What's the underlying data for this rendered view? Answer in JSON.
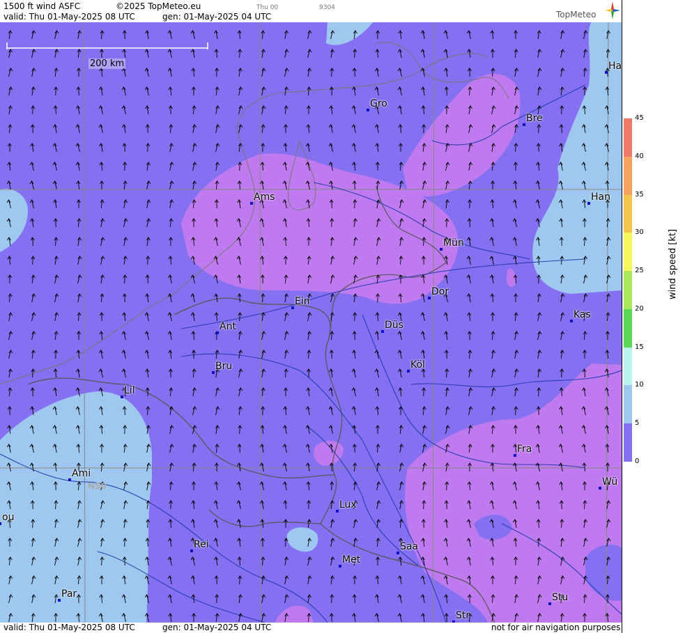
{
  "header": {
    "product": "1500 ft wind ASFC",
    "copyright": "©2025 TopMeteo.eu",
    "run": "Thu 00",
    "code": "9304",
    "valid": "valid:  Thu  01-May-2025  08 UTC",
    "gen": "gen: 01-May-2025 04 UTC",
    "logo": "TopMeteo"
  },
  "footer": {
    "valid": "valid:  Thu  01-May-2025  08 UTC",
    "gen": "gen: 01-May-2025 04 UTC",
    "disclaimer": "not for air navigation purposes"
  },
  "map": {
    "scale_label": "200 km",
    "latitude_label": "N50",
    "cities": [
      {
        "name": "Gro"
      },
      {
        "name": "Bre"
      },
      {
        "name": "Ha"
      },
      {
        "name": "Ams"
      },
      {
        "name": "Han"
      },
      {
        "name": "Mün"
      },
      {
        "name": "Dor"
      },
      {
        "name": "Ein"
      },
      {
        "name": "Kas"
      },
      {
        "name": "Düs"
      },
      {
        "name": "Ant"
      },
      {
        "name": "Köl"
      },
      {
        "name": "Bru"
      },
      {
        "name": "Lil"
      },
      {
        "name": "Fra"
      },
      {
        "name": "Ami"
      },
      {
        "name": "Wü"
      },
      {
        "name": "Lux"
      },
      {
        "name": "ou"
      },
      {
        "name": "Rei"
      },
      {
        "name": "Saa"
      },
      {
        "name": "Met"
      },
      {
        "name": "Par"
      },
      {
        "name": "Stu"
      },
      {
        "name": "Str"
      }
    ]
  },
  "legend": {
    "title": "wind speed [kt]",
    "ticks": [
      "45",
      "40",
      "35",
      "30",
      "25",
      "20",
      "15",
      "10",
      "5",
      "0"
    ],
    "colors": [
      "#f07a6a",
      "#f5a35e",
      "#f3c44e",
      "#f5f560",
      "#a8e85a",
      "#5ad85a",
      "#b8f3f0",
      "#9fc8f0",
      "#8470f0",
      "#c07af0"
    ]
  },
  "colors": {
    "calm": "#c07af0",
    "light": "#8470f0",
    "moderate": "#9fc8f0",
    "city_marker": "#1010c8",
    "river": "#2a3fb0",
    "border": "#666666"
  }
}
